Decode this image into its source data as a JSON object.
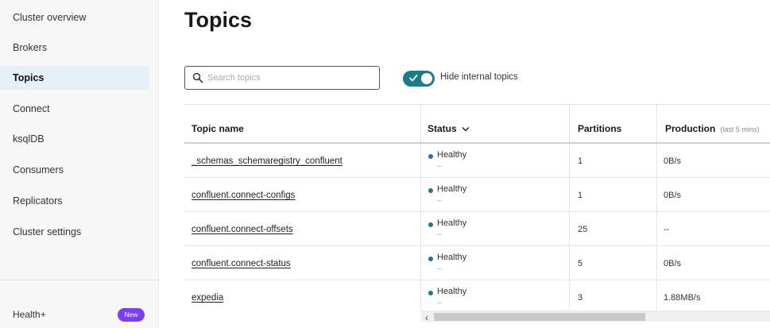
{
  "sidebar": {
    "items": [
      {
        "label": "Cluster overview",
        "active": false
      },
      {
        "label": "Brokers",
        "active": false
      },
      {
        "label": "Topics",
        "active": true
      },
      {
        "label": "Connect",
        "active": false
      },
      {
        "label": "ksqlDB",
        "active": false
      },
      {
        "label": "Consumers",
        "active": false
      },
      {
        "label": "Replicators",
        "active": false
      },
      {
        "label": "Cluster settings",
        "active": false
      }
    ],
    "health_label": "Health+",
    "new_badge": "New"
  },
  "page": {
    "title": "Topics"
  },
  "search": {
    "placeholder": "Search topics",
    "value": ""
  },
  "toggle": {
    "label": "Hide internal topics",
    "on": true
  },
  "table": {
    "columns": {
      "name": "Topic name",
      "status": "Status",
      "partitions": "Partitions",
      "production": "Production",
      "production_sub": "(last 5 mins)"
    },
    "rows": [
      {
        "name": "_schemas_schemaregistry_confluent",
        "status": "Healthy",
        "status_sub": "--",
        "partitions": "1",
        "production": "0B/s"
      },
      {
        "name": "confluent.connect-configs",
        "status": "Healthy",
        "status_sub": "--",
        "partitions": "1",
        "production": "0B/s"
      },
      {
        "name": "confluent.connect-offsets",
        "status": "Healthy",
        "status_sub": "--",
        "partitions": "25",
        "production": "--"
      },
      {
        "name": "confluent.connect-status",
        "status": "Healthy",
        "status_sub": "--",
        "partitions": "5",
        "production": "0B/s"
      },
      {
        "name": "expedia",
        "status": "Healthy",
        "status_sub": "--",
        "partitions": "3",
        "production": "1.88MB/s"
      }
    ]
  },
  "colors": {
    "accent": "#1a7c8a",
    "active_nav": "#e5f0f8",
    "badge": "#7a3ff2"
  },
  "icons": [
    "search-icon",
    "checkmark-icon",
    "chevron-down-icon",
    "scroll-left-icon"
  ]
}
